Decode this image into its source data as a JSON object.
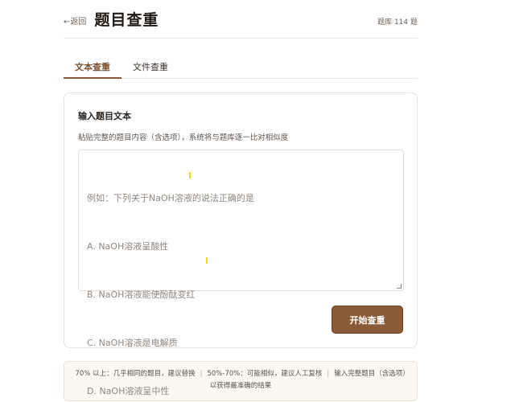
{
  "header": {
    "back_label": "←返回",
    "title": "题目查重",
    "bank_count": "题库 114 题"
  },
  "tabs": [
    {
      "label": "文本查重",
      "active": true
    },
    {
      "label": "文件查重",
      "active": false
    }
  ],
  "card": {
    "title": "输入题目文本",
    "description": "粘贴完整的题目内容（含选项），系统将与题库逐一比对相似度",
    "placeholder_lines": [
      "例如：下列关于NaOH溶液的说法正确的是",
      "A. NaOH溶液呈酸性",
      "B. NaOH溶液能使酚酞变红",
      "C. NaOH溶液是电解质",
      "D. NaOH溶液呈中性"
    ],
    "submit_label": "开始查重"
  },
  "legend": {
    "item1": "70% 以上：几乎相同的题目，建议替换",
    "separator": "|",
    "item2": "50%-70%：可能相似，建议人工复核",
    "item3": "输入完整题目（含选项）以获得最准确的结果"
  },
  "colors": {
    "accent": "#8b5a36",
    "tab_active": "#7a5230",
    "legend_bg": "#fcf7f1"
  }
}
